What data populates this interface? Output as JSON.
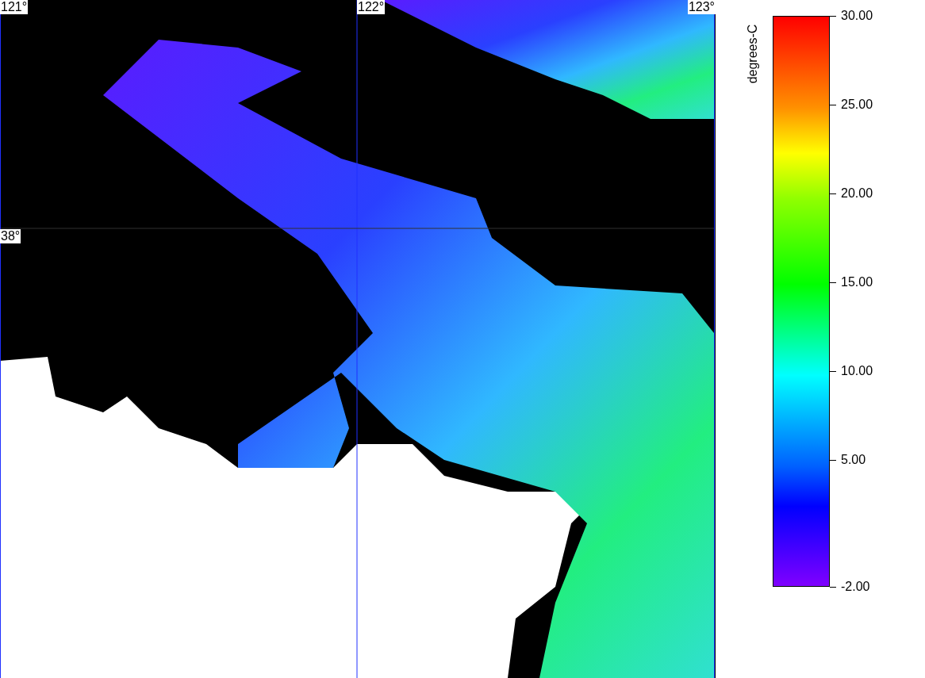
{
  "map": {
    "longitude_labels": [
      "121°",
      "122°",
      "123°"
    ],
    "latitude_labels": [
      "38°"
    ]
  },
  "legend": {
    "title": "degrees-C",
    "ticks": [
      "30.00",
      "25.00",
      "20.00",
      "15.00",
      "10.00",
      "5.00",
      "-2.00"
    ]
  }
}
